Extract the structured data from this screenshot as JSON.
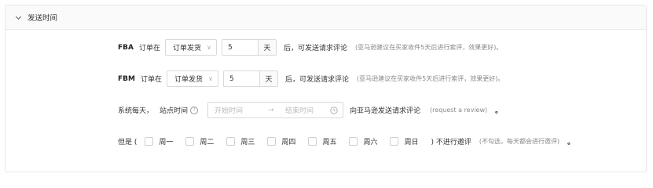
{
  "panel": {
    "title": "发送时间"
  },
  "fba_row": {
    "label": "FBA",
    "order_at": "订单在",
    "select_value": "订单发货",
    "days_value": "5",
    "unit": "天",
    "after_text": "后，可发送请求评论",
    "hint": "(亚马逊建议在买家收件5天后进行索评，效果更好)。"
  },
  "fbm_row": {
    "label": "FBM",
    "order_at": "订单在",
    "select_value": "订单发货",
    "days_value": "5",
    "unit": "天",
    "after_text": "后，可发送请求评论",
    "hint": "(亚马逊建议在买家收件5天后进行索评，效果更好)。"
  },
  "daily_row": {
    "prefix": "系统每天，",
    "site_time_label": "站点时间",
    "start_placeholder": "开始时间",
    "separator": "→",
    "end_placeholder": "结束时间",
    "action_text": "向亚马逊发送请求评论",
    "hint": "(request a review)",
    "period": "。"
  },
  "days_row": {
    "prefix": "但是 (",
    "days": [
      "周一",
      "周二",
      "周三",
      "周四",
      "周五",
      "周六",
      "周日"
    ],
    "suffix": ") 不进行邀评",
    "hint": "(不勾选，每天都会进行邀评)",
    "period": "。"
  }
}
